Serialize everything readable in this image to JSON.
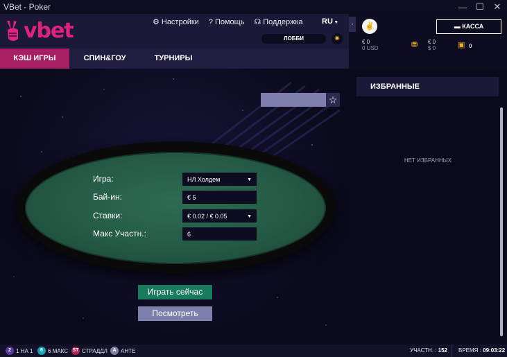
{
  "window": {
    "title": "VBet - Poker",
    "controls": [
      "—",
      "☐",
      "✕"
    ]
  },
  "header": {
    "logo_text": "vbet",
    "links": [
      {
        "icon": "gear-icon",
        "label": "Настройки"
      },
      {
        "icon": "help-icon",
        "label": "Помощь"
      },
      {
        "icon": "headset-icon",
        "label": "Поддержка"
      }
    ],
    "language": "RU",
    "lobby_label": "ЛОББИ"
  },
  "tabs": [
    {
      "label": "КЭШ ИГРЫ",
      "active": true
    },
    {
      "label": "СПИН&ГОУ",
      "active": false
    },
    {
      "label": "ТУРНИРЫ",
      "active": false
    }
  ],
  "form": {
    "game_label": "Игра:",
    "game_value": "НЛ Холдем",
    "buyin_label": "Бай-ин:",
    "buyin_value": "€ 5",
    "stakes_label": "Ставки:",
    "stakes_value": "€ 0.02 / € 0.05",
    "maxplayers_label": "Макс Участн.:",
    "maxplayers_value": "6"
  },
  "actions": {
    "play_now": "Играть сейчас",
    "watch": "Посмотреть"
  },
  "account": {
    "balance_eur": "€ 0",
    "balance_usd": "0 USD",
    "bonus_eur": "€ 0",
    "bonus_usd": "$ 0",
    "tickets": "0",
    "cashier_label": "КАССА"
  },
  "favorites": {
    "title": "ИЗБРАННЫЕ",
    "empty": "НЕТ ИЗБРАННЫХ"
  },
  "footer": {
    "legend": [
      {
        "badge": "2",
        "label": "1 НА 1",
        "color": "#5b3aa0"
      },
      {
        "badge": "6",
        "label": "6 МАКС",
        "color": "#1aa0b8"
      },
      {
        "badge": "ST",
        "label": "СТРАДДЛ",
        "color": "#b02050"
      },
      {
        "badge": "A",
        "label": "АНТЕ",
        "color": "#8080a0"
      }
    ],
    "players_label": "УЧАСТН. :",
    "players_value": "152",
    "time_label": "ВРЕМЯ :",
    "time_value": "09:03:22"
  }
}
